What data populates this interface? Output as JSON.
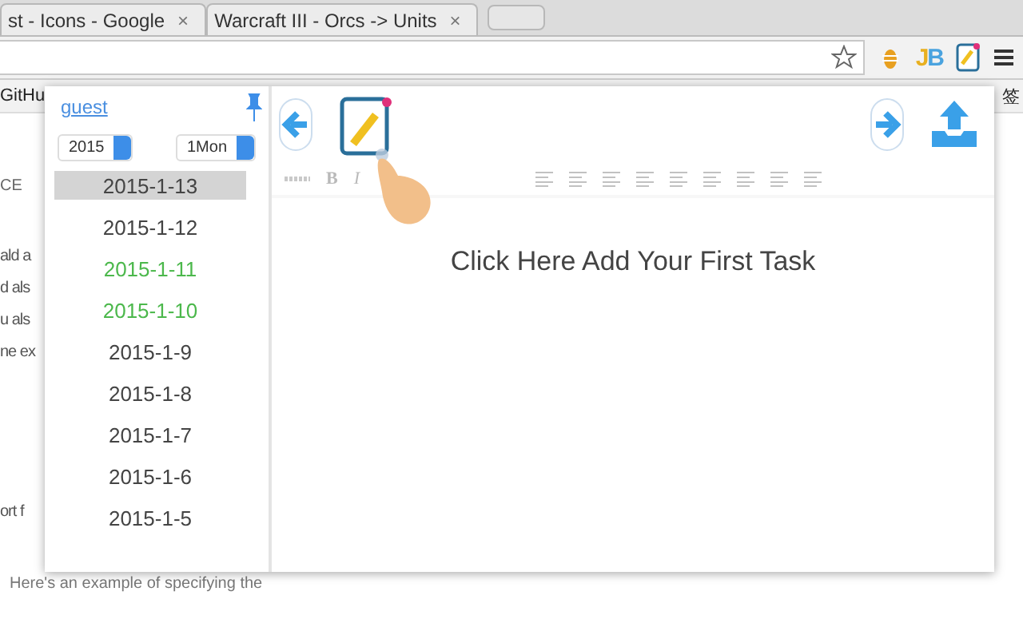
{
  "browser": {
    "tabs": [
      {
        "title": "st - Icons - Google",
        "close": "×"
      },
      {
        "title": "Warcraft III - Orcs -> Units",
        "close": "×"
      }
    ],
    "extension_label": "JB",
    "bookmarks": {
      "left": "GitHu",
      "right": "签"
    }
  },
  "background_page": {
    "heading": "CE",
    "lines": [
      "ald a",
      "d als",
      "u als",
      "ne ex"
    ],
    "line_after": "ort f",
    "footer_line": "Here's an example of specifying the"
  },
  "popup": {
    "user": "guest",
    "year": "2015",
    "month": "1Mon",
    "dates": [
      {
        "label": "2015-1-13",
        "selected": true,
        "color": "#444444"
      },
      {
        "label": "2015-1-12",
        "selected": false,
        "color": "#444444"
      },
      {
        "label": "2015-1-11",
        "selected": false,
        "color": "#4cb84c"
      },
      {
        "label": "2015-1-10",
        "selected": false,
        "color": "#4cb84c"
      },
      {
        "label": "2015-1-9",
        "selected": false,
        "color": "#444444"
      },
      {
        "label": "2015-1-8",
        "selected": false,
        "color": "#444444"
      },
      {
        "label": "2015-1-7",
        "selected": false,
        "color": "#444444"
      },
      {
        "label": "2015-1-6",
        "selected": false,
        "color": "#444444"
      },
      {
        "label": "2015-1-5",
        "selected": false,
        "color": "#444444"
      }
    ],
    "editor_toolbar": [
      "B",
      "I"
    ],
    "message": "Click Here Add Your First Task"
  }
}
